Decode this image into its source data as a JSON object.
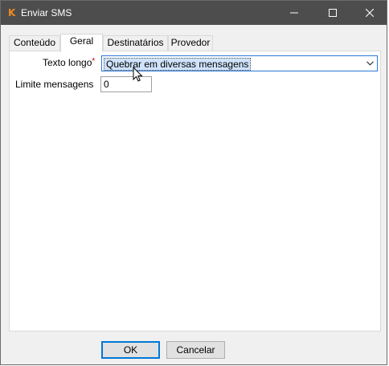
{
  "window": {
    "title": "Enviar SMS",
    "app_icon_glyph": "K",
    "controls": [
      "minimize-icon",
      "maximize-icon",
      "close-icon"
    ]
  },
  "tabs": [
    {
      "label": "Conteúdo",
      "active": false
    },
    {
      "label": "Geral",
      "active": true
    },
    {
      "label": "Destinatários",
      "active": false
    },
    {
      "label": "Provedor",
      "active": false
    }
  ],
  "form": {
    "long_text": {
      "label": "Texto longo",
      "required_mark": "*",
      "value": "Quebrar em diversas mensagens"
    },
    "message_limit": {
      "label": "Limite mensagens",
      "value": "0"
    }
  },
  "buttons": {
    "ok": "OK",
    "cancel": "Cancelar"
  },
  "colors": {
    "titlebar": "#4d4d4d",
    "accent": "#0078d7",
    "app_icon": "#f08a1c",
    "required": "#cc0000"
  }
}
